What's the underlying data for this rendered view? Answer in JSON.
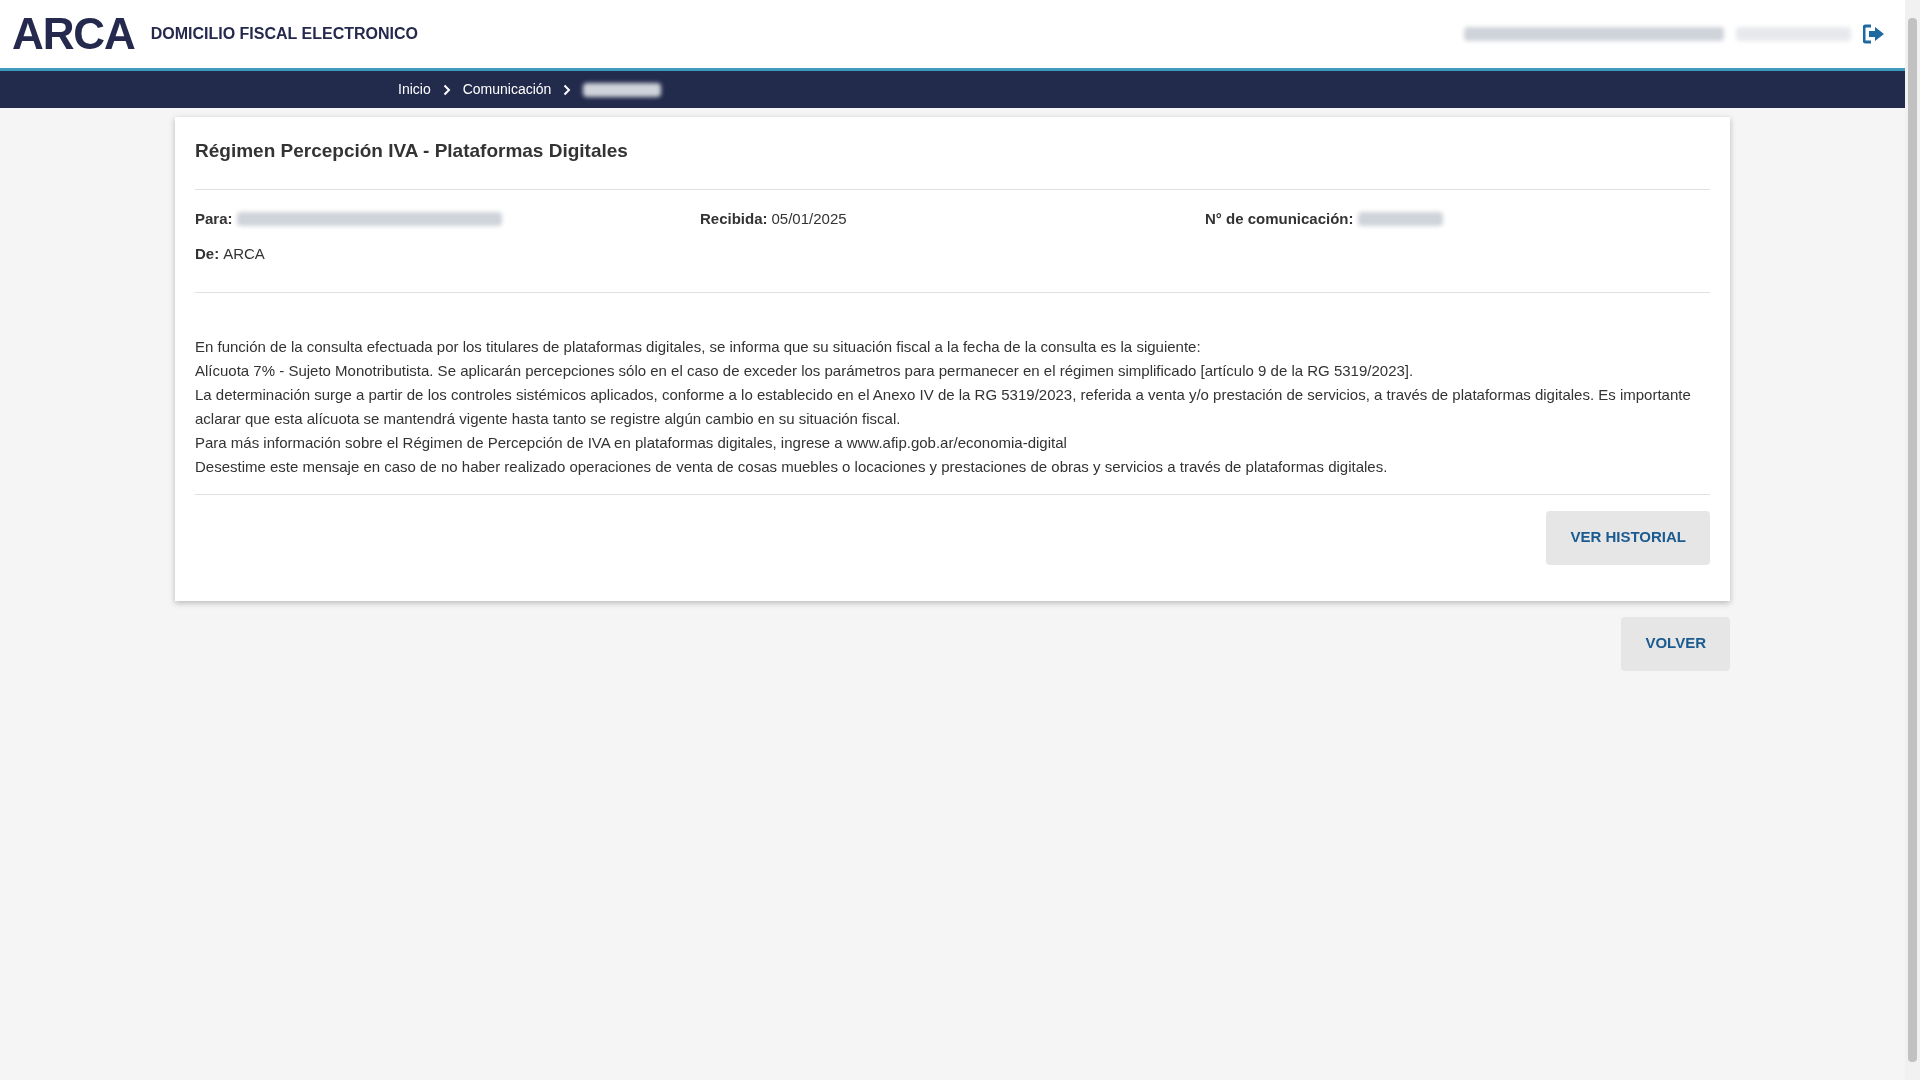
{
  "header": {
    "logo": "ARCA",
    "title": "DOMICILIO FISCAL ELECTRONICO"
  },
  "breadcrumb": [
    {
      "label": "Inicio"
    },
    {
      "label": "Comunicación"
    }
  ],
  "message": {
    "title": "Régimen Percepción IVA - Plataformas Digitales",
    "para_label": "Para:",
    "recibida_label": "Recibida:",
    "recibida_value": "05/01/2025",
    "numero_label": "N° de comunicación:",
    "de_label": "De:",
    "de_value": "ARCA",
    "body": [
      "En función de la consulta efectuada por los titulares de plataformas digitales, se informa que su situación fiscal a la fecha de la consulta es la siguiente:",
      "Alícuota 7% - Sujeto Monotributista. Se aplicarán percepciones sólo en el caso de exceder los parámetros para permanecer en el régimen simplificado [artículo 9 de la RG 5319/2023].",
      "La determinación surge a partir de los controles sistémicos aplicados, conforme a lo establecido en el Anexo IV de la RG 5319/2023, referida a venta y/o prestación de servicios, a través de plataformas digitales. Es importante aclarar que esta alícuota se mantendrá vigente hasta tanto se registre algún cambio en su situación fiscal.",
      "Para más información sobre el Régimen de Percepción de IVA en plataformas digitales, ingrese a www.afip.gob.ar/economia-digital",
      "Desestime este mensaje en caso de no haber realizado operaciones de venta de cosas muebles o locaciones y prestaciones de obras y servicios a través de plataformas digitales."
    ],
    "history_button": "VER HISTORIAL"
  },
  "back_button": "VOLVER"
}
